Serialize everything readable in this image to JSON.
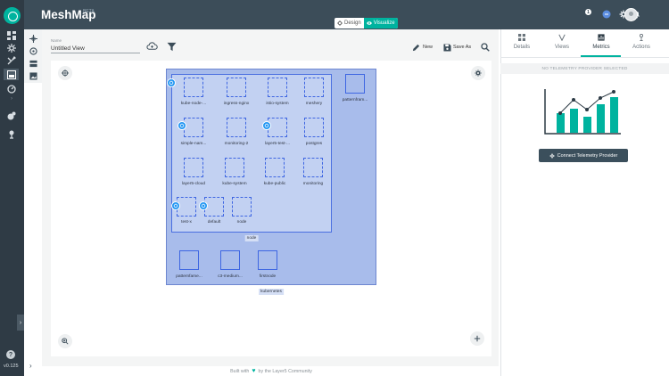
{
  "app": {
    "title": "MeshMap",
    "beta": "BETA",
    "version": "v0.125",
    "mode_tabs": [
      "Design",
      "Visualize"
    ],
    "active_mode": "Visualize",
    "notification_count": "1"
  },
  "sidebar": {
    "icons": [
      "dashboard-icon",
      "configuration-icon",
      "lifecycle-icon",
      "meshmap-icon",
      "performance-icon",
      "conformance-icon",
      "extensions-icon"
    ],
    "expand_label": "›",
    "help_label": "?"
  },
  "toolbar": {
    "name_label": "Name",
    "name_value": "Untitled View",
    "new_label": "New",
    "save_as_label": "Save As"
  },
  "canvas": {
    "kubernetes_label": "kubernetes",
    "node_label": "node",
    "namespaces": [
      {
        "label": "kube-node-..."
      },
      {
        "label": "ingress-nginx"
      },
      {
        "label": "istio-system"
      },
      {
        "label": "meshery"
      },
      {
        "label": "simple-nam..."
      },
      {
        "label": "monitoring-2"
      },
      {
        "label": "layer5-test-..."
      },
      {
        "label": "postgres"
      },
      {
        "label": "layer5-cloud"
      },
      {
        "label": "kube-system"
      },
      {
        "label": "kube-public"
      },
      {
        "label": "monitoring"
      },
      {
        "label": "test-x"
      },
      {
        "label": "default"
      },
      {
        "label": "node"
      }
    ],
    "outside_items": [
      {
        "label": "patternfram..."
      },
      {
        "label": "patternfame..."
      },
      {
        "label": "c3-medium..."
      },
      {
        "label": "firstnode"
      }
    ]
  },
  "right_panel": {
    "tabs": [
      "Details",
      "Views",
      "Metrics",
      "Actions"
    ],
    "active_tab": "Metrics",
    "no_telemetry": "NO TELEMETRY PROVIDER SELECTED",
    "connect_button": "Connect Telemetry Provider"
  },
  "footer": {
    "built_with": "Built with",
    "by": "by the Layer5 Community"
  },
  "colors": {
    "header": "#3c4d59",
    "sidebar": "#2f3b45",
    "accent": "#00b39f",
    "cluster_fill": "#a8bceb",
    "node_border": "#4a6fe0"
  }
}
